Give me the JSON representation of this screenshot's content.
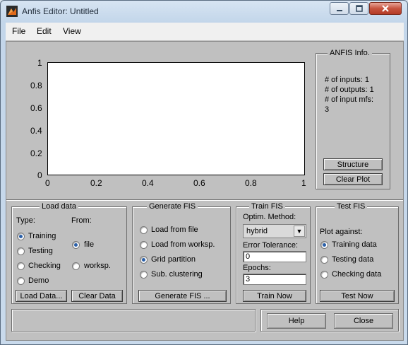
{
  "window": {
    "title": "Anfis Editor: Untitled"
  },
  "menu": {
    "items": [
      "File",
      "Edit",
      "View"
    ]
  },
  "plot": {
    "y_ticks": [
      "1",
      "0.8",
      "0.6",
      "0.4",
      "0.2",
      "0"
    ],
    "x_ticks": [
      "0",
      "0.2",
      "0.4",
      "0.6",
      "0.8",
      "1"
    ]
  },
  "anfis_info": {
    "title": "ANFIS Info.",
    "inputs": "# of inputs: 1",
    "outputs": "# of outputs: 1",
    "mfs_label": "# of input mfs:",
    "mfs_value": "3",
    "structure_btn": "Structure",
    "clear_plot_btn": "Clear Plot"
  },
  "load_data": {
    "title": "Load data",
    "type_label": "Type:",
    "from_label": "From:",
    "types": [
      "Training",
      "Testing",
      "Checking",
      "Demo"
    ],
    "selected_type": 0,
    "sources": [
      "file",
      "worksp."
    ],
    "selected_source": 0,
    "load_btn": "Load Data...",
    "clear_btn": "Clear Data"
  },
  "generate_fis": {
    "title": "Generate FIS",
    "options": [
      "Load from file",
      "Load from worksp.",
      "Grid partition",
      "Sub. clustering"
    ],
    "selected": 2,
    "generate_btn": "Generate FIS ..."
  },
  "train_fis": {
    "title": "Train FIS",
    "method_label": "Optim. Method:",
    "method_value": "hybrid",
    "tolerance_label": "Error Tolerance:",
    "tolerance_value": "0",
    "epochs_label": "Epochs:",
    "epochs_value": "3",
    "train_btn": "Train Now"
  },
  "test_fis": {
    "title": "Test FIS",
    "plot_against_label": "Plot against:",
    "options": [
      "Training data",
      "Testing data",
      "Checking data"
    ],
    "selected": 0,
    "test_btn": "Test Now"
  },
  "footer": {
    "help_btn": "Help",
    "close_btn": "Close"
  }
}
